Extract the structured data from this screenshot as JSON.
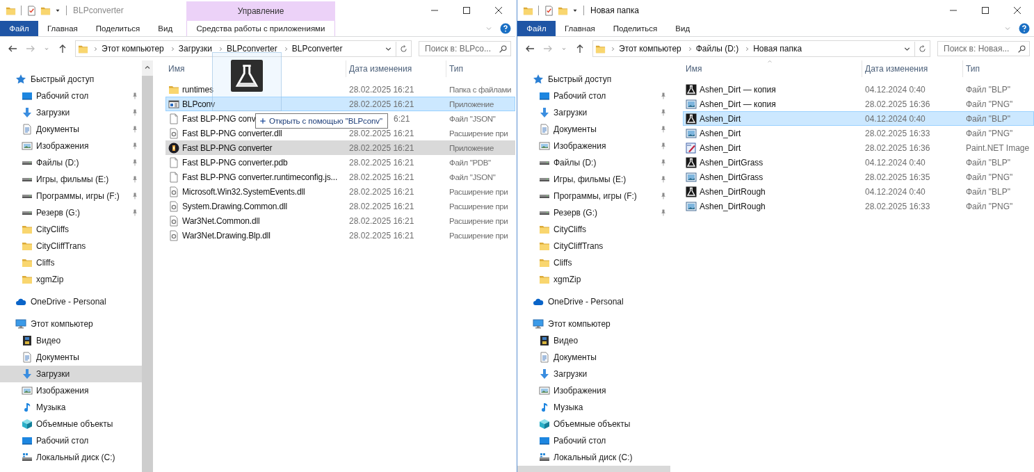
{
  "windows": [
    {
      "title": "BLPconverter",
      "active": false,
      "context_tab": {
        "group": "Управление",
        "label": "Средства работы с приложениями"
      },
      "ribbon_tabs": [
        {
          "label": "Файл",
          "kind": "file"
        },
        {
          "label": "Главная",
          "kind": "tab"
        },
        {
          "label": "Поделиться",
          "kind": "tab"
        },
        {
          "label": "Вид",
          "kind": "tab"
        }
      ],
      "path": [
        "Этот компьютер",
        "Загрузки",
        "BLPconverter",
        "BLPconverter"
      ],
      "search": {
        "placeholder": "Поиск в: BLPco..."
      },
      "sidebar_scrollbar": true,
      "sidebar": [
        {
          "label": "Быстрый доступ",
          "kind": "star",
          "selected": false,
          "children": [
            {
              "label": "Рабочий стол",
              "kind": "desktop",
              "pinned": true,
              "selected": false
            },
            {
              "label": "Загрузки",
              "kind": "download",
              "pinned": true,
              "selected": false
            },
            {
              "label": "Документы",
              "kind": "docs",
              "pinned": true,
              "selected": false
            },
            {
              "label": "Изображения",
              "kind": "images",
              "pinned": true,
              "selected": false
            },
            {
              "label": "Файлы (D:)",
              "kind": "drive",
              "pinned": true,
              "selected": false
            },
            {
              "label": "Игры, фильмы (E:)",
              "kind": "drive",
              "pinned": true,
              "selected": false
            },
            {
              "label": "Программы, игры (F:)",
              "kind": "drive",
              "pinned": true,
              "selected": false
            },
            {
              "label": "Резерв (G:)",
              "kind": "drive",
              "pinned": true,
              "selected": false
            },
            {
              "label": "CityCliffs",
              "kind": "folder",
              "pinned": false,
              "selected": false
            },
            {
              "label": "CityCliffTrans",
              "kind": "folder",
              "pinned": false,
              "selected": false
            },
            {
              "label": "Cliffs",
              "kind": "folder",
              "pinned": false,
              "selected": false
            },
            {
              "label": "xgmZip",
              "kind": "folder",
              "pinned": false,
              "selected": false
            }
          ]
        },
        {
          "label": "OneDrive - Personal",
          "kind": "cloud",
          "selected": false
        },
        {
          "label": "Этот компьютер",
          "kind": "pc",
          "selected": false,
          "children": [
            {
              "label": "Видео",
              "kind": "video",
              "pinned": false,
              "selected": false
            },
            {
              "label": "Документы",
              "kind": "docs",
              "pinned": false,
              "selected": false
            },
            {
              "label": "Загрузки",
              "kind": "download",
              "pinned": false,
              "selected": true
            },
            {
              "label": "Изображения",
              "kind": "images",
              "pinned": false,
              "selected": false
            },
            {
              "label": "Музыка",
              "kind": "music",
              "pinned": false,
              "selected": false
            },
            {
              "label": "Объемные объекты",
              "kind": "cube",
              "pinned": false,
              "selected": false
            },
            {
              "label": "Рабочий стол",
              "kind": "desktop",
              "pinned": false,
              "selected": false
            },
            {
              "label": "Локальный диск (C:)",
              "kind": "localdisk",
              "pinned": false,
              "selected": false
            }
          ]
        }
      ],
      "columns": [
        {
          "label": "Имя"
        },
        {
          "label": "Дата изменения"
        },
        {
          "label": "Тип"
        }
      ],
      "files": [
        {
          "name": "runtimes",
          "modified": "28.02.2025 16:21",
          "type": "Папка с файлами",
          "kind": "folder",
          "selected": false,
          "hovered": false
        },
        {
          "name": "BLPconv",
          "modified": "28.02.2025 16:21",
          "type": "Приложение",
          "kind": "app",
          "selected": true,
          "hovered": false
        },
        {
          "name": "Fast BLP-PNG conv",
          "modified": "6:21",
          "type": "Файл \"JSON\"",
          "kind": "file",
          "selected": false,
          "hovered": false,
          "cut": true
        },
        {
          "name": "Fast BLP-PNG converter.dll",
          "modified": "28.02.2025 16:21",
          "type": "Расширение при",
          "kind": "dll",
          "selected": false,
          "hovered": false
        },
        {
          "name": "Fast BLP-PNG converter",
          "modified": "28.02.2025 16:21",
          "type": "Приложение",
          "kind": "roundapp",
          "selected": false,
          "hovered": true
        },
        {
          "name": "Fast BLP-PNG converter.pdb",
          "modified": "28.02.2025 16:21",
          "type": "Файл \"PDB\"",
          "kind": "file",
          "selected": false,
          "hovered": false
        },
        {
          "name": "Fast BLP-PNG converter.runtimeconfig.js...",
          "modified": "28.02.2025 16:21",
          "type": "Файл \"JSON\"",
          "kind": "file",
          "selected": false,
          "hovered": false
        },
        {
          "name": "Microsoft.Win32.SystemEvents.dll",
          "modified": "28.02.2025 16:21",
          "type": "Расширение при",
          "kind": "dll",
          "selected": false,
          "hovered": false
        },
        {
          "name": "System.Drawing.Common.dll",
          "modified": "28.02.2025 16:21",
          "type": "Расширение при",
          "kind": "dll",
          "selected": false,
          "hovered": false
        },
        {
          "name": "War3Net.Common.dll",
          "modified": "28.02.2025 16:21",
          "type": "Расширение при",
          "kind": "dll",
          "selected": false,
          "hovered": false
        },
        {
          "name": "War3Net.Drawing.Blp.dll",
          "modified": "28.02.2025 16:21",
          "type": "Расширение при",
          "kind": "dll",
          "selected": false,
          "hovered": false
        }
      ],
      "drag": {
        "tooltip": "Открыть с помощью \"BLPconv\""
      }
    },
    {
      "title": "Новая папка",
      "active": true,
      "ribbon_tabs": [
        {
          "label": "Файл",
          "kind": "file"
        },
        {
          "label": "Главная",
          "kind": "tab"
        },
        {
          "label": "Поделиться",
          "kind": "tab"
        },
        {
          "label": "Вид",
          "kind": "tab"
        }
      ],
      "path": [
        "Этот компьютер",
        "Файлы (D:)",
        "Новая папка"
      ],
      "search": {
        "placeholder": "Поиск в: Новая..."
      },
      "sidebar_scrollbar": false,
      "sidebar": [
        {
          "label": "Быстрый доступ",
          "kind": "star",
          "selected": false,
          "children": [
            {
              "label": "Рабочий стол",
              "kind": "desktop",
              "pinned": true,
              "selected": false
            },
            {
              "label": "Загрузки",
              "kind": "download",
              "pinned": true,
              "selected": false
            },
            {
              "label": "Документы",
              "kind": "docs",
              "pinned": true,
              "selected": false
            },
            {
              "label": "Изображения",
              "kind": "images",
              "pinned": true,
              "selected": false
            },
            {
              "label": "Файлы (D:)",
              "kind": "drive",
              "pinned": true,
              "selected": false
            },
            {
              "label": "Игры, фильмы (E:)",
              "kind": "drive",
              "pinned": true,
              "selected": false
            },
            {
              "label": "Программы, игры (F:)",
              "kind": "drive",
              "pinned": true,
              "selected": false
            },
            {
              "label": "Резерв (G:)",
              "kind": "drive",
              "pinned": true,
              "selected": false
            },
            {
              "label": "CityCliffs",
              "kind": "folder",
              "pinned": false,
              "selected": false
            },
            {
              "label": "CityCliffTrans",
              "kind": "folder",
              "pinned": false,
              "selected": false
            },
            {
              "label": "Cliffs",
              "kind": "folder",
              "pinned": false,
              "selected": false
            },
            {
              "label": "xgmZip",
              "kind": "folder",
              "pinned": false,
              "selected": false
            }
          ]
        },
        {
          "label": "OneDrive - Personal",
          "kind": "cloud",
          "selected": false
        },
        {
          "label": "Этот компьютер",
          "kind": "pc",
          "selected": false,
          "children": [
            {
              "label": "Видео",
              "kind": "video",
              "pinned": false,
              "selected": false
            },
            {
              "label": "Документы",
              "kind": "docs",
              "pinned": false,
              "selected": false
            },
            {
              "label": "Загрузки",
              "kind": "download",
              "pinned": false,
              "selected": false
            },
            {
              "label": "Изображения",
              "kind": "images",
              "pinned": false,
              "selected": false
            },
            {
              "label": "Музыка",
              "kind": "music",
              "pinned": false,
              "selected": false
            },
            {
              "label": "Объемные объекты",
              "kind": "cube",
              "pinned": false,
              "selected": false
            },
            {
              "label": "Рабочий стол",
              "kind": "desktop",
              "pinned": false,
              "selected": false
            },
            {
              "label": "Локальный диск (C:)",
              "kind": "localdisk",
              "pinned": false,
              "selected": false
            },
            {
              "pinned": false,
              "selected": true
            }
          ]
        }
      ],
      "columns": [
        {
          "label": "Имя",
          "sorted": true
        },
        {
          "label": "Дата изменения",
          "sorted": false
        },
        {
          "label": "Тип",
          "sorted": false
        }
      ],
      "files": [
        {
          "name": "Ashen_Dirt — копия",
          "modified": "04.12.2024 0:40",
          "type": "Файл \"BLP\"",
          "kind": "blp",
          "selected": false,
          "hovered": false
        },
        {
          "name": "Ashen_Dirt — копия",
          "modified": "28.02.2025 16:36",
          "type": "Файл \"PNG\"",
          "kind": "png",
          "selected": false,
          "hovered": false
        },
        {
          "name": "Ashen_Dirt",
          "modified": "04.12.2024 0:40",
          "type": "Файл \"BLP\"",
          "kind": "blp",
          "selected": true,
          "hovered": false
        },
        {
          "name": "Ashen_Dirt",
          "modified": "28.02.2025 16:33",
          "type": "Файл \"PNG\"",
          "kind": "png",
          "selected": false,
          "hovered": false
        },
        {
          "name": "Ashen_Dirt",
          "modified": "28.02.2025 16:36",
          "type": "Paint.NET Image",
          "kind": "pdn",
          "selected": false,
          "hovered": false
        },
        {
          "name": "Ashen_DirtGrass",
          "modified": "04.12.2024 0:40",
          "type": "Файл \"BLP\"",
          "kind": "blp",
          "selected": false,
          "hovered": false
        },
        {
          "name": "Ashen_DirtGrass",
          "modified": "28.02.2025 16:35",
          "type": "Файл \"PNG\"",
          "kind": "png",
          "selected": false,
          "hovered": false
        },
        {
          "name": "Ashen_DirtRough",
          "modified": "04.12.2024 0:40",
          "type": "Файл \"BLP\"",
          "kind": "blp",
          "selected": false,
          "hovered": false
        },
        {
          "name": "Ashen_DirtRough",
          "modified": "28.02.2025 16:33",
          "type": "Файл \"PNG\"",
          "kind": "png",
          "selected": false,
          "hovered": false
        }
      ]
    }
  ]
}
